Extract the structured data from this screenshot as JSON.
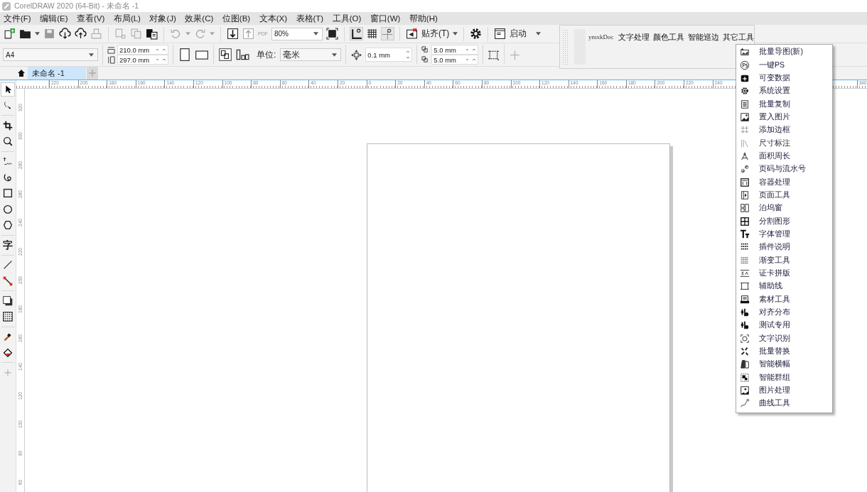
{
  "window": {
    "title": "CorelDRAW 2020 (64-Bit) - 未命名 -1"
  },
  "menu_bar": [
    "文件(F)",
    "编辑(E)",
    "查看(V)",
    "布局(L)",
    "对象(J)",
    "效果(C)",
    "位图(B)",
    "文本(X)",
    "表格(T)",
    "工具(O)",
    "窗口(W)",
    "帮助(H)"
  ],
  "standard_toolbar": {
    "pdf_label": "PDF",
    "zoom": "80%",
    "snap_label": "贴齐(T)",
    "launch_label": "启动"
  },
  "property_bar": {
    "page_size": "A4",
    "width": "210.0 mm",
    "height": "297.0 mm",
    "unit_label": "单位:",
    "unit": "毫米",
    "nudge": "0.1 mm",
    "duplicate_x": "5.0 mm",
    "duplicate_y": "5.0 mm"
  },
  "plugin_toolbar": {
    "brand": "ymxkDoc",
    "tabs": [
      "文字处理",
      "颜色工具",
      "智能巡边",
      "其它工具"
    ]
  },
  "document_tabs": [
    {
      "label": "未命名 -1",
      "selected": true
    }
  ],
  "toolbox": [
    {
      "selected": true
    },
    {
      "selected": false
    },
    {
      "selected": false
    },
    {
      "selected": false
    },
    {
      "selected": false
    },
    {
      "selected": false
    },
    {
      "selected": false
    },
    {
      "selected": false
    },
    {
      "selected": false
    },
    {
      "selected": false,
      "glyph": "字"
    },
    {
      "selected": false
    },
    {
      "selected": false
    },
    {
      "selected": false
    },
    {
      "selected": false
    },
    {
      "selected": false
    },
    {
      "selected": false
    }
  ],
  "rulers": {
    "top_labels": [
      "220",
      "200",
      "180",
      "160",
      "140",
      "120",
      "100",
      "80",
      "60",
      "40",
      "20",
      "0",
      "20",
      "40",
      "60",
      "80",
      "100",
      "120",
      "140",
      "160",
      "180",
      "200",
      "220",
      "240"
    ],
    "top_end_label": "340",
    "left_labels": [
      "320",
      "300",
      "280",
      "260",
      "240",
      "220",
      "200",
      "180",
      "160",
      "140",
      "120",
      "100",
      "80",
      "60"
    ]
  },
  "plugin_menu": {
    "items": [
      "批量导图(新)",
      "一键PS",
      "可变数据",
      "系统设置",
      "批量复制",
      "置入图片",
      "添加边框",
      "尺寸标注",
      "面积周长",
      "页码与流水号",
      "容器处理",
      "页面工具",
      "泊坞窗",
      "分割图形",
      "字体管理",
      "插件说明",
      "渐变工具",
      "证卡拼版",
      "辅助线",
      "素材工具",
      "对齐分布",
      "测试专用",
      "文字识别",
      "批量替换",
      "智能横幅",
      "智能群组",
      "图片处理",
      "曲线工具"
    ]
  }
}
